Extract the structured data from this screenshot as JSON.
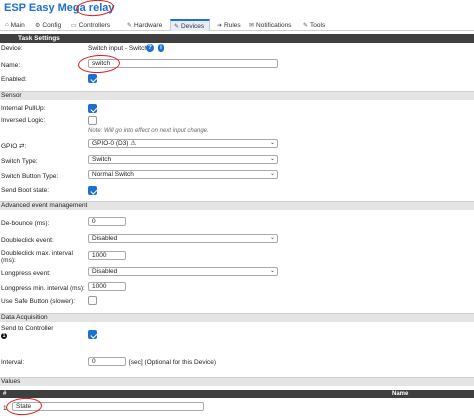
{
  "app": {
    "title": "ESP Easy Mega",
    "title_suffix": "relay"
  },
  "tabs": [
    {
      "label": "Main",
      "icon": "home-icon"
    },
    {
      "label": "Config",
      "icon": "gear-icon"
    },
    {
      "label": "Controllers",
      "icon": "controller-icon"
    },
    {
      "label": "Hardware",
      "icon": "pin-icon"
    },
    {
      "label": "Devices",
      "icon": "plug-icon",
      "active": true
    },
    {
      "label": "Rules",
      "icon": "arrow-icon"
    },
    {
      "label": "Notifications",
      "icon": "mail-icon"
    },
    {
      "label": "Tools",
      "icon": "wrench-icon"
    }
  ],
  "task_settings": {
    "header": "Task Settings",
    "device_label": "Device:",
    "device_value": "Switch input - Switch",
    "name_label": "Name:",
    "name_value": "switch",
    "enabled_label": "Enabled:",
    "enabled": true
  },
  "sensor": {
    "header": "Sensor",
    "pullup_label": "Internal PullUp:",
    "pullup": true,
    "inversed_label": "Inversed Logic:",
    "inversed": false,
    "inversed_note": "Note: Will go into effect on next input change.",
    "gpio_label": "GPIO ⇄:",
    "gpio_value": "GPIO-0 (D3) ⚠",
    "switch_type_label": "Switch Type:",
    "switch_type_value": "Switch",
    "switch_button_type_label": "Switch Button Type:",
    "switch_button_type_value": "Normal Switch",
    "send_boot_label": "Send Boot state:",
    "send_boot": true
  },
  "advanced": {
    "header": "Advanced event management",
    "debounce_label": "De-bounce (ms):",
    "debounce_value": "0",
    "doubleclick_label": "Doubleclick event:",
    "doubleclick_value": "Disabled",
    "doubleclick_max_label_1": "Doubleclick max. interval",
    "doubleclick_max_label_2": "(ms):",
    "doubleclick_max_value": "1000",
    "longpress_label": "Longpress event:",
    "longpress_value": "Disabled",
    "longpress_min_label": "Longpress min. interval (ms):",
    "longpress_min_value": "1000",
    "safe_button_label": "Use Safe Button (slower):",
    "safe_button": false
  },
  "data_acquisition": {
    "header": "Data Acquisition",
    "send_controller_label": "Send to Controller",
    "send_controller_num": "1",
    "send_controller": true,
    "interval_label": "Interval:",
    "interval_value": "0",
    "interval_note": "[sec] (Optional for this Device)"
  },
  "values": {
    "header": "Values",
    "col_num": "#",
    "col_name": "Name",
    "rows": [
      {
        "num": "1",
        "name": "State"
      }
    ]
  },
  "colors": {
    "accent": "#1d6fd1",
    "header_bg": "#3f3f3f",
    "section_bg": "#e4e4e4",
    "annotation": "#e01818"
  }
}
